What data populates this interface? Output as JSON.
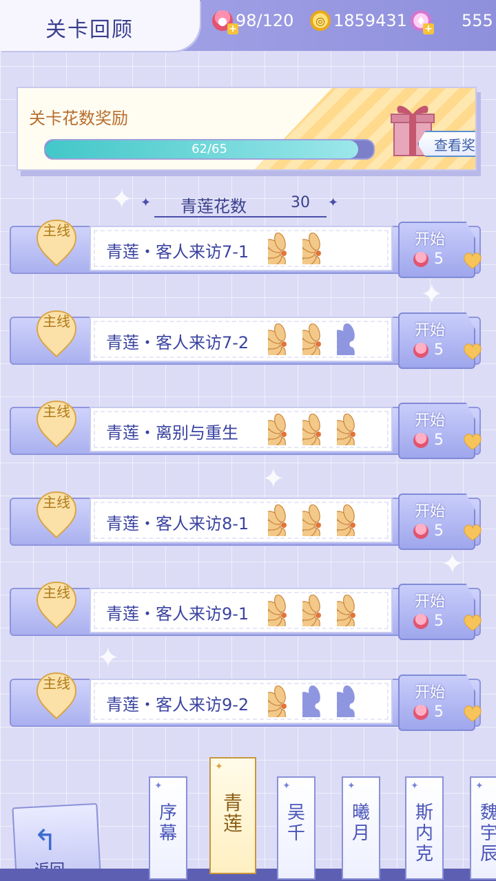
{
  "header": {
    "title": "关卡回顾",
    "stamina": "98/120",
    "coins": "1859431",
    "diamonds": "555"
  },
  "reward": {
    "title": "关卡花数奖励",
    "progress_text": "62/65",
    "progress_fraction": 0.954,
    "view_button": "查看奖励"
  },
  "counter": {
    "label": "青莲花数",
    "value": "30"
  },
  "stages": [
    {
      "badge": "主线",
      "name": "青莲・客人来访7-1",
      "flowers_earned": 2,
      "flowers_total": 2,
      "start_label": "开始",
      "cost": "5"
    },
    {
      "badge": "主线",
      "name": "青莲・客人来访7-2",
      "flowers_earned": 2,
      "flowers_total": 3,
      "start_label": "开始",
      "cost": "5"
    },
    {
      "badge": "主线",
      "name": "青莲・离别与重生",
      "flowers_earned": 3,
      "flowers_total": 3,
      "start_label": "开始",
      "cost": "5"
    },
    {
      "badge": "主线",
      "name": "青莲・客人来访8-1",
      "flowers_earned": 3,
      "flowers_total": 3,
      "start_label": "开始",
      "cost": "5"
    },
    {
      "badge": "主线",
      "name": "青莲・客人来访9-1",
      "flowers_earned": 3,
      "flowers_total": 3,
      "start_label": "开始",
      "cost": "5"
    },
    {
      "badge": "主线",
      "name": "青莲・客人来访9-2",
      "flowers_earned": 1,
      "flowers_total": 3,
      "start_label": "开始",
      "cost": "5"
    }
  ],
  "nav": {
    "back_label": "返回",
    "chapters": [
      {
        "label": "序\n幕",
        "active": false
      },
      {
        "label": "青\n莲",
        "active": true
      },
      {
        "label": "吴\n千",
        "active": false
      },
      {
        "label": "曦\n月",
        "active": false
      },
      {
        "label": "斯\n内\n克",
        "active": false
      },
      {
        "label": "魏\n宇\n辰",
        "active": false
      }
    ]
  },
  "colors": {
    "accent": "#3a43a0",
    "progress": "#42c7c8",
    "flower_earned": "#f3c98a",
    "flower_empty": "#8f96e0"
  }
}
